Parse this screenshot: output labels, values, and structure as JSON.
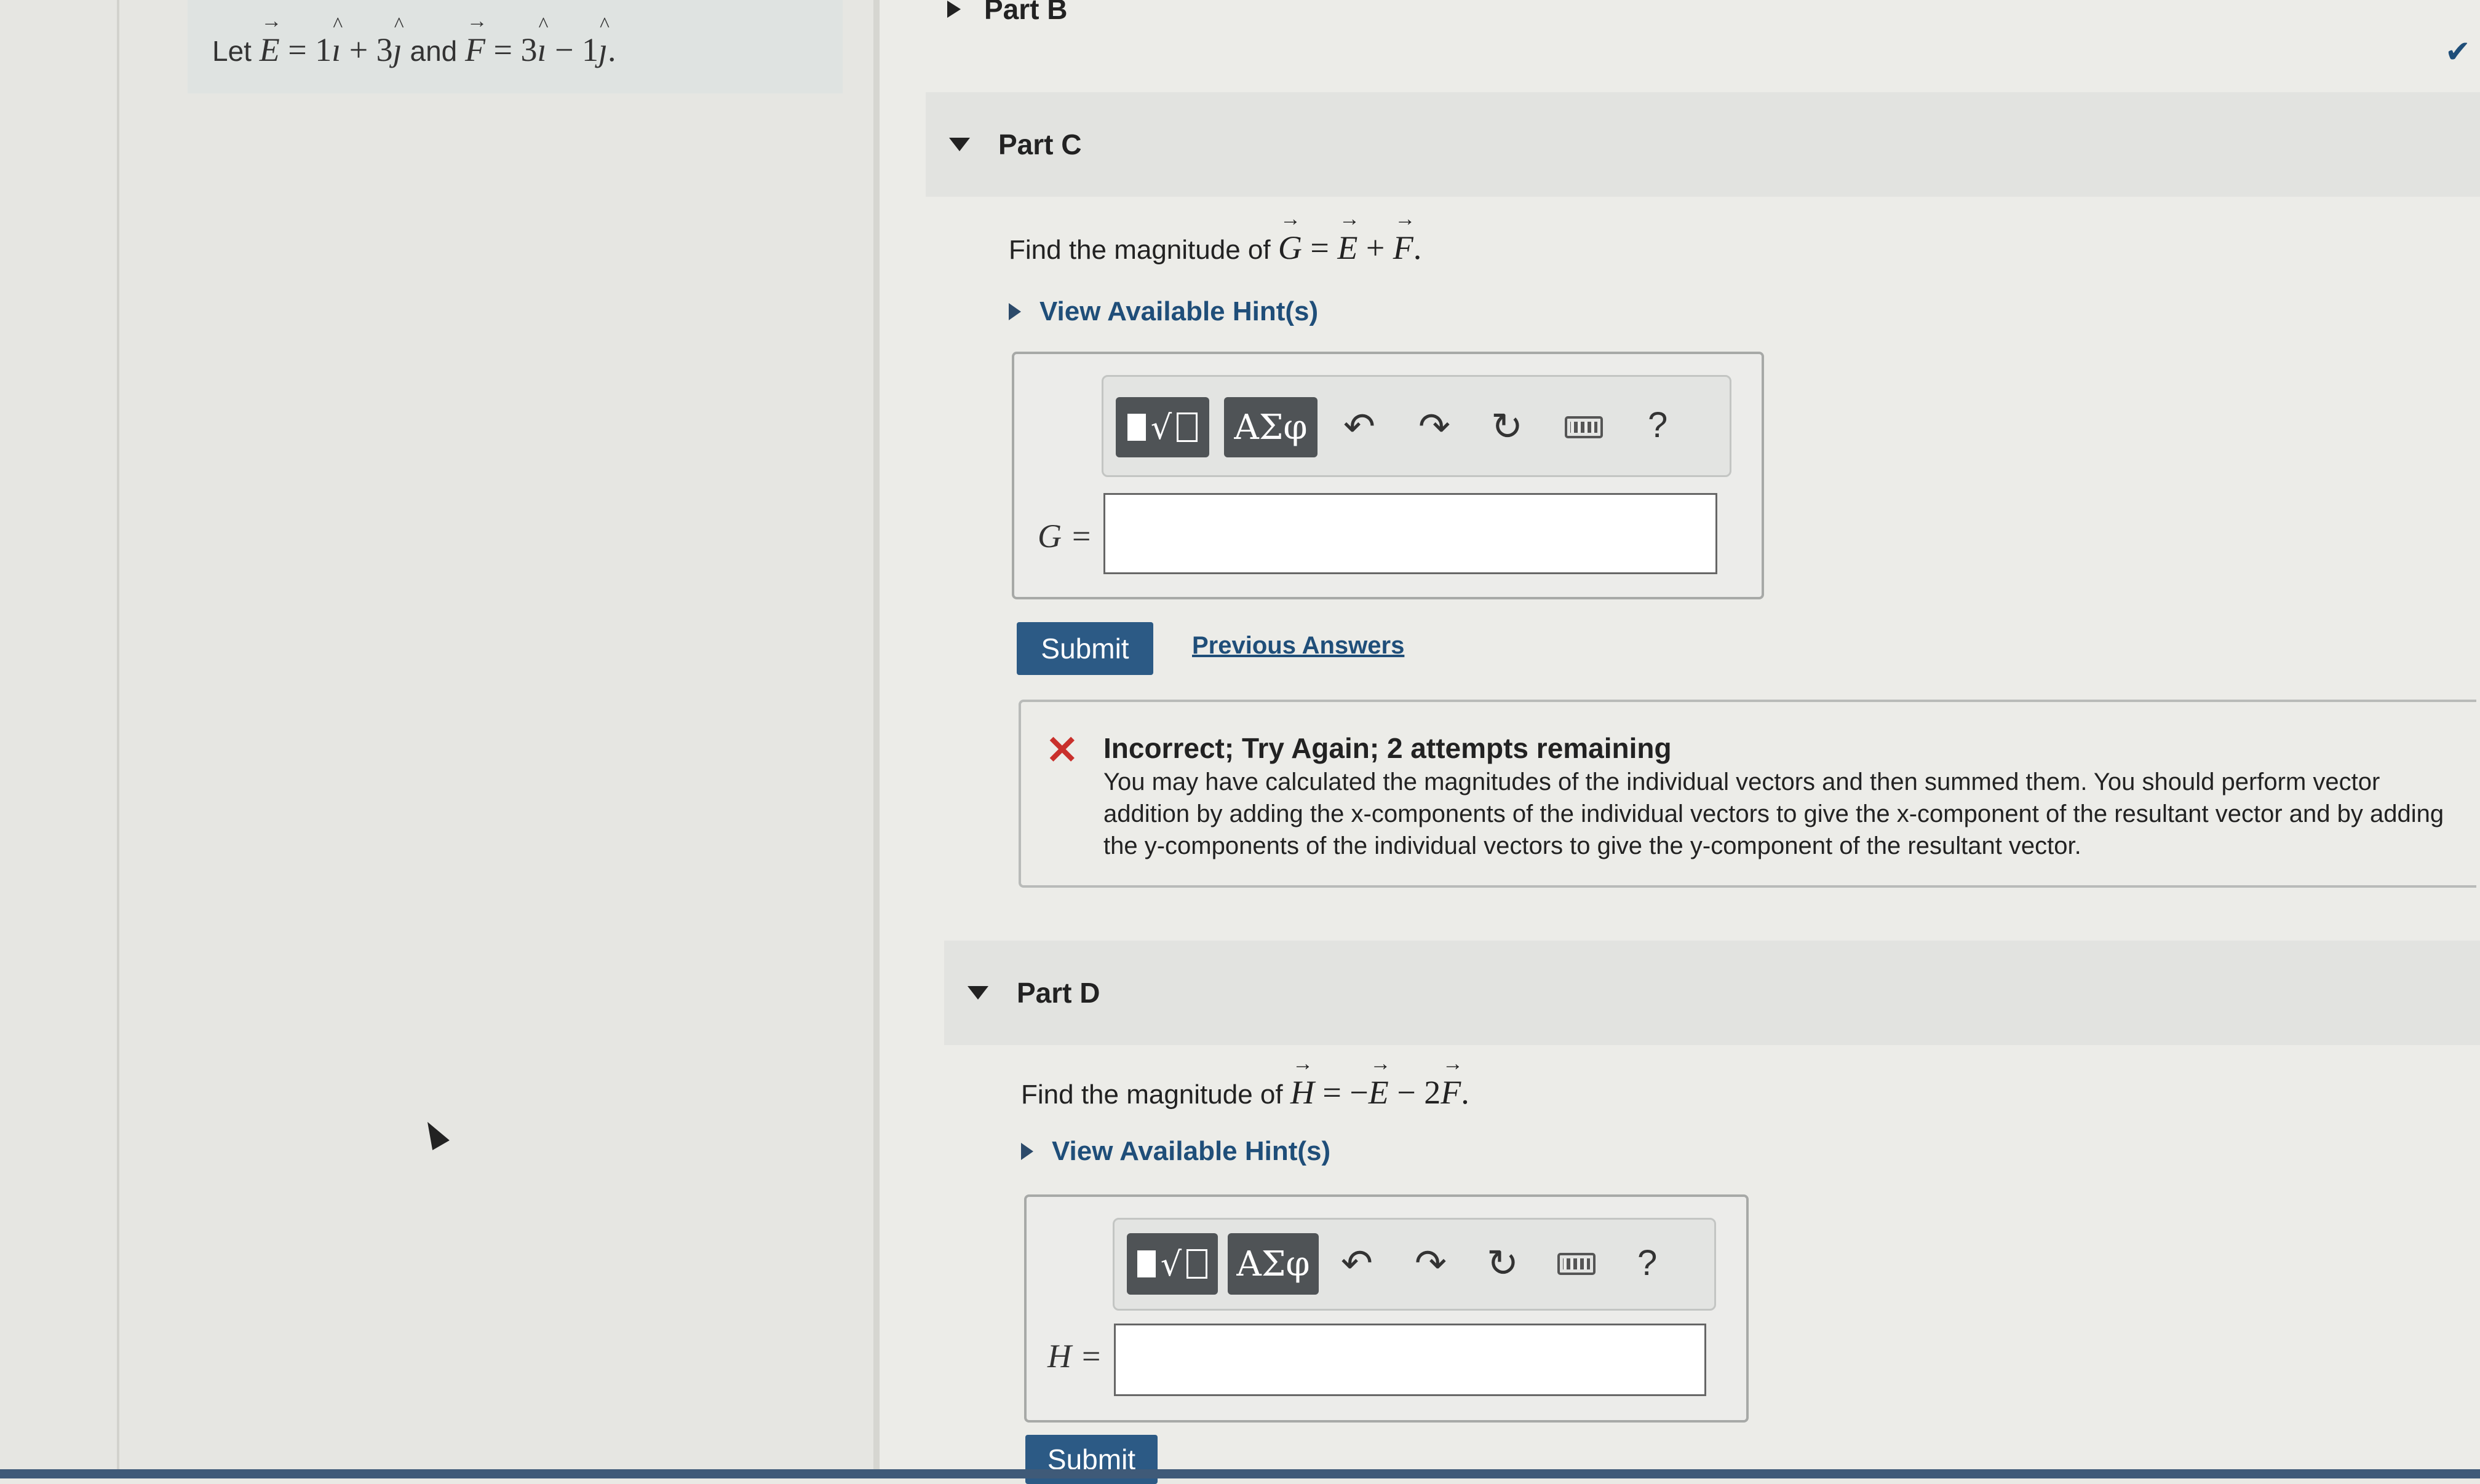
{
  "problem": {
    "prefix": "Let",
    "E_expr": "E = 1i + 3j",
    "connector": "and",
    "F_expr": "F = 3i − 1j"
  },
  "part_b": {
    "title": "Part B"
  },
  "part_c": {
    "title": "Part C",
    "prompt_prefix": "Find the magnitude of",
    "prompt_math": "G = E + F",
    "hint_label": "View Available Hint(s)",
    "var_label": "G =",
    "input_value": "",
    "submit_label": "Submit",
    "previous_answers_label": "Previous Answers"
  },
  "toolbar": {
    "greek_label": "ΑΣφ",
    "help_label": "?",
    "icons": [
      "templates-icon",
      "greek-letters-icon",
      "undo-icon",
      "redo-icon",
      "reset-icon",
      "keyboard-icon",
      "help-icon"
    ]
  },
  "feedback": {
    "title": "Incorrect; Try Again; 2 attempts remaining",
    "body": "You may have calculated the magnitudes of the individual vectors and then summed them. You should perform vector addition by adding the x-components of the individual vectors to give the x-component of the resultant vector and by adding the y-components of the individual vectors to give the y-component of the resultant vector.",
    "status_color": "#c9302c"
  },
  "part_d": {
    "title": "Part D",
    "prompt_prefix": "Find the magnitude of",
    "prompt_math": "H = −E − 2F",
    "hint_label": "View Available Hint(s)",
    "var_label": "H =",
    "input_value": "",
    "submit_label": "Submit"
  },
  "colors": {
    "accent": "#2c5a85",
    "link": "#1f4e79",
    "toolbar_button": "#4f5356"
  }
}
